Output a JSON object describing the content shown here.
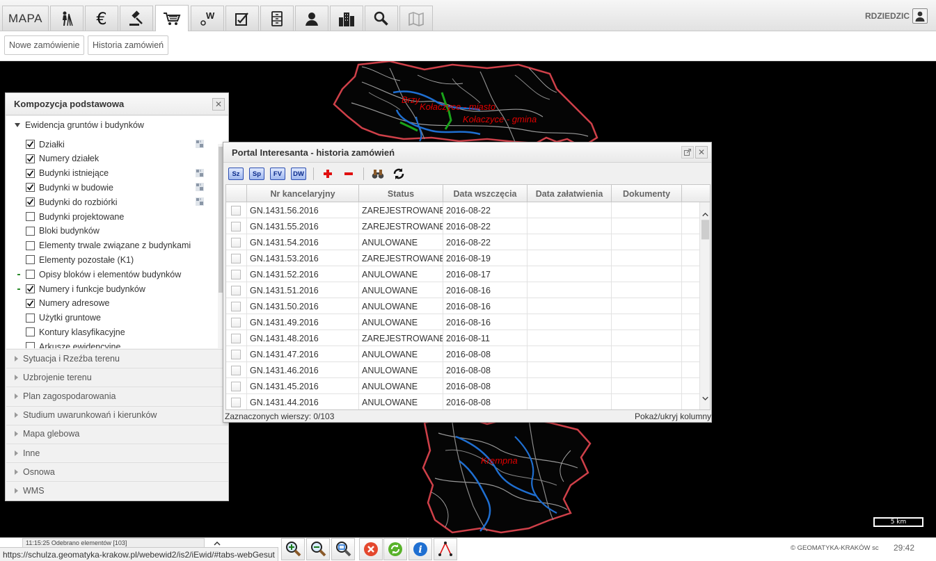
{
  "nav": {
    "mapa_label": "MAPA",
    "tabs": [
      {
        "icon": "surveyor-icon"
      },
      {
        "icon": "euro-icon"
      },
      {
        "icon": "gavel-icon"
      },
      {
        "icon": "cart-icon"
      },
      {
        "icon": "owner-icon"
      },
      {
        "icon": "edit-document-icon"
      },
      {
        "icon": "registry-icon"
      },
      {
        "icon": "person-icon"
      },
      {
        "icon": "buildings-icon"
      },
      {
        "icon": "search-icon"
      },
      {
        "icon": "map-book-icon"
      }
    ],
    "active_tab": "cart-icon",
    "user": "RDZIEDZIC"
  },
  "subnav": {
    "new_order": "Nowe zamówienie",
    "order_history": "Historia zamówień"
  },
  "map": {
    "labels": [
      {
        "text": "Brzy"
      },
      {
        "text": "Kołaczyce - miasto"
      },
      {
        "text": "Kołaczyce - gmina"
      },
      {
        "text": "Krempna"
      }
    ],
    "scale": "5 km"
  },
  "layers": {
    "title": "Kompozycja podstawowa",
    "open_group": "Ewidencja gruntów i budynków",
    "items": [
      {
        "label": "Działki",
        "checked": true,
        "legend": true
      },
      {
        "label": "Numery działek",
        "checked": true,
        "legend": false
      },
      {
        "label": "Budynki istniejące",
        "checked": true,
        "legend": true
      },
      {
        "label": "Budynki w budowie",
        "checked": true,
        "legend": true
      },
      {
        "label": "Budynki do rozbiórki",
        "checked": true,
        "legend": true
      },
      {
        "label": "Budynki projektowane",
        "checked": false,
        "legend": false
      },
      {
        "label": "Bloki budynków",
        "checked": false,
        "legend": false
      },
      {
        "label": "Elementy trwale związane z budynkami",
        "checked": false,
        "legend": false
      },
      {
        "label": "Elementy pozostałe (K1)",
        "checked": false,
        "legend": false
      },
      {
        "label": "Opisy bloków i elementów budynków",
        "checked": false,
        "legend": false
      },
      {
        "label": "Numery i funkcje budynków",
        "checked": true,
        "legend": false
      },
      {
        "label": "Numery adresowe",
        "checked": true,
        "legend": false
      },
      {
        "label": "Użytki gruntowe",
        "checked": false,
        "legend": false
      },
      {
        "label": "Kontury klasyfikacyjne",
        "checked": false,
        "legend": false
      },
      {
        "label": "Arkusze ewidencyjne",
        "checked": false,
        "legend": false
      }
    ],
    "groups": [
      "Sytuacja i Rzeźba terenu",
      "Uzbrojenie terenu",
      "Plan zagospodarowania",
      "Studium uwarunkowań i kierunków",
      "Mapa glebowa",
      "Inne",
      "Osnowa",
      "WMS"
    ]
  },
  "dialog": {
    "title": "Portal Interesanta - historia zamówień",
    "toolbar": [
      "Sz",
      "Sp",
      "FV",
      "DW"
    ],
    "columns": [
      "Nr kancelaryjny",
      "Status",
      "Data wszczęcia",
      "Data załatwienia",
      "Dokumenty"
    ],
    "rows": [
      {
        "nr": "GN.1431.56.2016",
        "status": "ZAREJESTROWANE",
        "start": "2016-08-22",
        "done": "",
        "docs": ""
      },
      {
        "nr": "GN.1431.55.2016",
        "status": "ZAREJESTROWANE",
        "start": "2016-08-22",
        "done": "",
        "docs": ""
      },
      {
        "nr": "GN.1431.54.2016",
        "status": "ANULOWANE",
        "start": "2016-08-22",
        "done": "",
        "docs": ""
      },
      {
        "nr": "GN.1431.53.2016",
        "status": "ZAREJESTROWANE",
        "start": "2016-08-19",
        "done": "",
        "docs": ""
      },
      {
        "nr": "GN.1431.52.2016",
        "status": "ANULOWANE",
        "start": "2016-08-17",
        "done": "",
        "docs": ""
      },
      {
        "nr": "GN.1431.51.2016",
        "status": "ANULOWANE",
        "start": "2016-08-16",
        "done": "",
        "docs": ""
      },
      {
        "nr": "GN.1431.50.2016",
        "status": "ANULOWANE",
        "start": "2016-08-16",
        "done": "",
        "docs": ""
      },
      {
        "nr": "GN.1431.49.2016",
        "status": "ANULOWANE",
        "start": "2016-08-16",
        "done": "",
        "docs": ""
      },
      {
        "nr": "GN.1431.48.2016",
        "status": "ZAREJESTROWANE",
        "start": "2016-08-11",
        "done": "",
        "docs": ""
      },
      {
        "nr": "GN.1431.47.2016",
        "status": "ANULOWANE",
        "start": "2016-08-08",
        "done": "",
        "docs": ""
      },
      {
        "nr": "GN.1431.46.2016",
        "status": "ANULOWANE",
        "start": "2016-08-08",
        "done": "",
        "docs": ""
      },
      {
        "nr": "GN.1431.45.2016",
        "status": "ANULOWANE",
        "start": "2016-08-08",
        "done": "",
        "docs": ""
      },
      {
        "nr": "GN.1431.44.2016",
        "status": "ANULOWANE",
        "start": "2016-08-08",
        "done": "",
        "docs": ""
      }
    ],
    "selected_rows": "Zaznaczonych wierszy: 0/103",
    "toggle_columns": "Pokaż/ukryj kolumny"
  },
  "footer": {
    "log": "11:15:25 Odebrano elementów [103]",
    "url": "https://schulza.geomatyka-krakow.pl/webewid2/is2/iEwid/#tabs-webGesut",
    "tools": [
      "zoom-in-icon",
      "zoom-out-icon",
      "zoom-extent-icon",
      "cancel-icon",
      "refresh-icon",
      "info-icon",
      "measure-icon"
    ],
    "copyright": "© GEOMATYKA-KRAKÓW sc",
    "timer": "29:42"
  },
  "colors": {
    "accent_blue": "#1f6fd1",
    "boundary_red": "#d0454d",
    "label_red": "#e00000",
    "map_bg": "#000000"
  }
}
